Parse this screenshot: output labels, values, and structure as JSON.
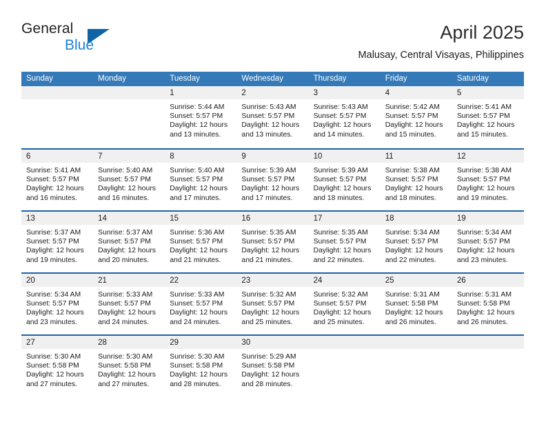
{
  "brand": {
    "name_part1": "General",
    "name_part2": "Blue",
    "triangle_color": "#1063a5",
    "blue_text_color": "#1b7fd4"
  },
  "header": {
    "month_title": "April 2025",
    "location": "Malusay, Central Visayas, Philippines"
  },
  "theme": {
    "header_row_bg": "#3479b8",
    "week_separator": "#1f62a8",
    "day_number_band_bg": "#f0f0f0",
    "text_color": "#1a1a1a"
  },
  "calendar": {
    "day_headers": [
      "Sunday",
      "Monday",
      "Tuesday",
      "Wednesday",
      "Thursday",
      "Friday",
      "Saturday"
    ],
    "weeks": [
      [
        {
          "empty": true
        },
        {
          "empty": true
        },
        {
          "day": "1",
          "sunrise": "Sunrise: 5:44 AM",
          "sunset": "Sunset: 5:57 PM",
          "daylight_line1": "Daylight: 12 hours",
          "daylight_line2": "and 13 minutes."
        },
        {
          "day": "2",
          "sunrise": "Sunrise: 5:43 AM",
          "sunset": "Sunset: 5:57 PM",
          "daylight_line1": "Daylight: 12 hours",
          "daylight_line2": "and 13 minutes."
        },
        {
          "day": "3",
          "sunrise": "Sunrise: 5:43 AM",
          "sunset": "Sunset: 5:57 PM",
          "daylight_line1": "Daylight: 12 hours",
          "daylight_line2": "and 14 minutes."
        },
        {
          "day": "4",
          "sunrise": "Sunrise: 5:42 AM",
          "sunset": "Sunset: 5:57 PM",
          "daylight_line1": "Daylight: 12 hours",
          "daylight_line2": "and 15 minutes."
        },
        {
          "day": "5",
          "sunrise": "Sunrise: 5:41 AM",
          "sunset": "Sunset: 5:57 PM",
          "daylight_line1": "Daylight: 12 hours",
          "daylight_line2": "and 15 minutes."
        }
      ],
      [
        {
          "day": "6",
          "sunrise": "Sunrise: 5:41 AM",
          "sunset": "Sunset: 5:57 PM",
          "daylight_line1": "Daylight: 12 hours",
          "daylight_line2": "and 16 minutes."
        },
        {
          "day": "7",
          "sunrise": "Sunrise: 5:40 AM",
          "sunset": "Sunset: 5:57 PM",
          "daylight_line1": "Daylight: 12 hours",
          "daylight_line2": "and 16 minutes."
        },
        {
          "day": "8",
          "sunrise": "Sunrise: 5:40 AM",
          "sunset": "Sunset: 5:57 PM",
          "daylight_line1": "Daylight: 12 hours",
          "daylight_line2": "and 17 minutes."
        },
        {
          "day": "9",
          "sunrise": "Sunrise: 5:39 AM",
          "sunset": "Sunset: 5:57 PM",
          "daylight_line1": "Daylight: 12 hours",
          "daylight_line2": "and 17 minutes."
        },
        {
          "day": "10",
          "sunrise": "Sunrise: 5:39 AM",
          "sunset": "Sunset: 5:57 PM",
          "daylight_line1": "Daylight: 12 hours",
          "daylight_line2": "and 18 minutes."
        },
        {
          "day": "11",
          "sunrise": "Sunrise: 5:38 AM",
          "sunset": "Sunset: 5:57 PM",
          "daylight_line1": "Daylight: 12 hours",
          "daylight_line2": "and 18 minutes."
        },
        {
          "day": "12",
          "sunrise": "Sunrise: 5:38 AM",
          "sunset": "Sunset: 5:57 PM",
          "daylight_line1": "Daylight: 12 hours",
          "daylight_line2": "and 19 minutes."
        }
      ],
      [
        {
          "day": "13",
          "sunrise": "Sunrise: 5:37 AM",
          "sunset": "Sunset: 5:57 PM",
          "daylight_line1": "Daylight: 12 hours",
          "daylight_line2": "and 19 minutes."
        },
        {
          "day": "14",
          "sunrise": "Sunrise: 5:37 AM",
          "sunset": "Sunset: 5:57 PM",
          "daylight_line1": "Daylight: 12 hours",
          "daylight_line2": "and 20 minutes."
        },
        {
          "day": "15",
          "sunrise": "Sunrise: 5:36 AM",
          "sunset": "Sunset: 5:57 PM",
          "daylight_line1": "Daylight: 12 hours",
          "daylight_line2": "and 21 minutes."
        },
        {
          "day": "16",
          "sunrise": "Sunrise: 5:35 AM",
          "sunset": "Sunset: 5:57 PM",
          "daylight_line1": "Daylight: 12 hours",
          "daylight_line2": "and 21 minutes."
        },
        {
          "day": "17",
          "sunrise": "Sunrise: 5:35 AM",
          "sunset": "Sunset: 5:57 PM",
          "daylight_line1": "Daylight: 12 hours",
          "daylight_line2": "and 22 minutes."
        },
        {
          "day": "18",
          "sunrise": "Sunrise: 5:34 AM",
          "sunset": "Sunset: 5:57 PM",
          "daylight_line1": "Daylight: 12 hours",
          "daylight_line2": "and 22 minutes."
        },
        {
          "day": "19",
          "sunrise": "Sunrise: 5:34 AM",
          "sunset": "Sunset: 5:57 PM",
          "daylight_line1": "Daylight: 12 hours",
          "daylight_line2": "and 23 minutes."
        }
      ],
      [
        {
          "day": "20",
          "sunrise": "Sunrise: 5:34 AM",
          "sunset": "Sunset: 5:57 PM",
          "daylight_line1": "Daylight: 12 hours",
          "daylight_line2": "and 23 minutes."
        },
        {
          "day": "21",
          "sunrise": "Sunrise: 5:33 AM",
          "sunset": "Sunset: 5:57 PM",
          "daylight_line1": "Daylight: 12 hours",
          "daylight_line2": "and 24 minutes."
        },
        {
          "day": "22",
          "sunrise": "Sunrise: 5:33 AM",
          "sunset": "Sunset: 5:57 PM",
          "daylight_line1": "Daylight: 12 hours",
          "daylight_line2": "and 24 minutes."
        },
        {
          "day": "23",
          "sunrise": "Sunrise: 5:32 AM",
          "sunset": "Sunset: 5:57 PM",
          "daylight_line1": "Daylight: 12 hours",
          "daylight_line2": "and 25 minutes."
        },
        {
          "day": "24",
          "sunrise": "Sunrise: 5:32 AM",
          "sunset": "Sunset: 5:57 PM",
          "daylight_line1": "Daylight: 12 hours",
          "daylight_line2": "and 25 minutes."
        },
        {
          "day": "25",
          "sunrise": "Sunrise: 5:31 AM",
          "sunset": "Sunset: 5:58 PM",
          "daylight_line1": "Daylight: 12 hours",
          "daylight_line2": "and 26 minutes."
        },
        {
          "day": "26",
          "sunrise": "Sunrise: 5:31 AM",
          "sunset": "Sunset: 5:58 PM",
          "daylight_line1": "Daylight: 12 hours",
          "daylight_line2": "and 26 minutes."
        }
      ],
      [
        {
          "day": "27",
          "sunrise": "Sunrise: 5:30 AM",
          "sunset": "Sunset: 5:58 PM",
          "daylight_line1": "Daylight: 12 hours",
          "daylight_line2": "and 27 minutes."
        },
        {
          "day": "28",
          "sunrise": "Sunrise: 5:30 AM",
          "sunset": "Sunset: 5:58 PM",
          "daylight_line1": "Daylight: 12 hours",
          "daylight_line2": "and 27 minutes."
        },
        {
          "day": "29",
          "sunrise": "Sunrise: 5:30 AM",
          "sunset": "Sunset: 5:58 PM",
          "daylight_line1": "Daylight: 12 hours",
          "daylight_line2": "and 28 minutes."
        },
        {
          "day": "30",
          "sunrise": "Sunrise: 5:29 AM",
          "sunset": "Sunset: 5:58 PM",
          "daylight_line1": "Daylight: 12 hours",
          "daylight_line2": "and 28 minutes."
        },
        {
          "empty": true
        },
        {
          "empty": true
        },
        {
          "empty": true
        }
      ]
    ]
  }
}
